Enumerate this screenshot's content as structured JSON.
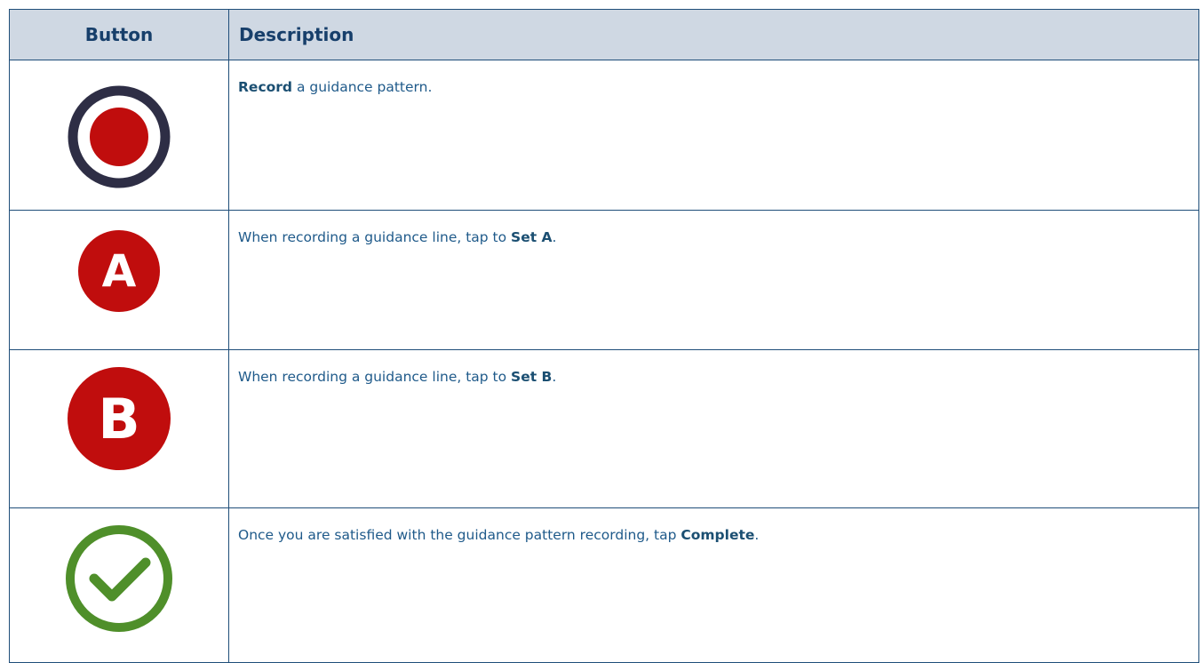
{
  "table": {
    "headers": {
      "button": "Button",
      "description": "Description"
    },
    "rows": [
      {
        "icon": "record-icon",
        "pre": "",
        "bold": "Record",
        "post": " a guidance pattern."
      },
      {
        "icon": "set-a-icon",
        "icon_letter": "A",
        "pre": "When recording a guidance line, tap to ",
        "bold": "Set A",
        "post": "."
      },
      {
        "icon": "set-b-icon",
        "icon_letter": "B",
        "pre": "When recording a guidance line, tap to ",
        "bold": "Set B",
        "post": "."
      },
      {
        "icon": "complete-check-icon",
        "pre": "Once you are satisfied with the guidance pattern recording, tap ",
        "bold": "Complete",
        "post": "."
      }
    ]
  },
  "colors": {
    "header_bg": "#cfd8e3",
    "border": "#1f4e79",
    "text": "#1f5a8a",
    "record_red": "#c00d0d",
    "record_ring": "#2e2e45",
    "check_green": "#4f8f2a"
  }
}
